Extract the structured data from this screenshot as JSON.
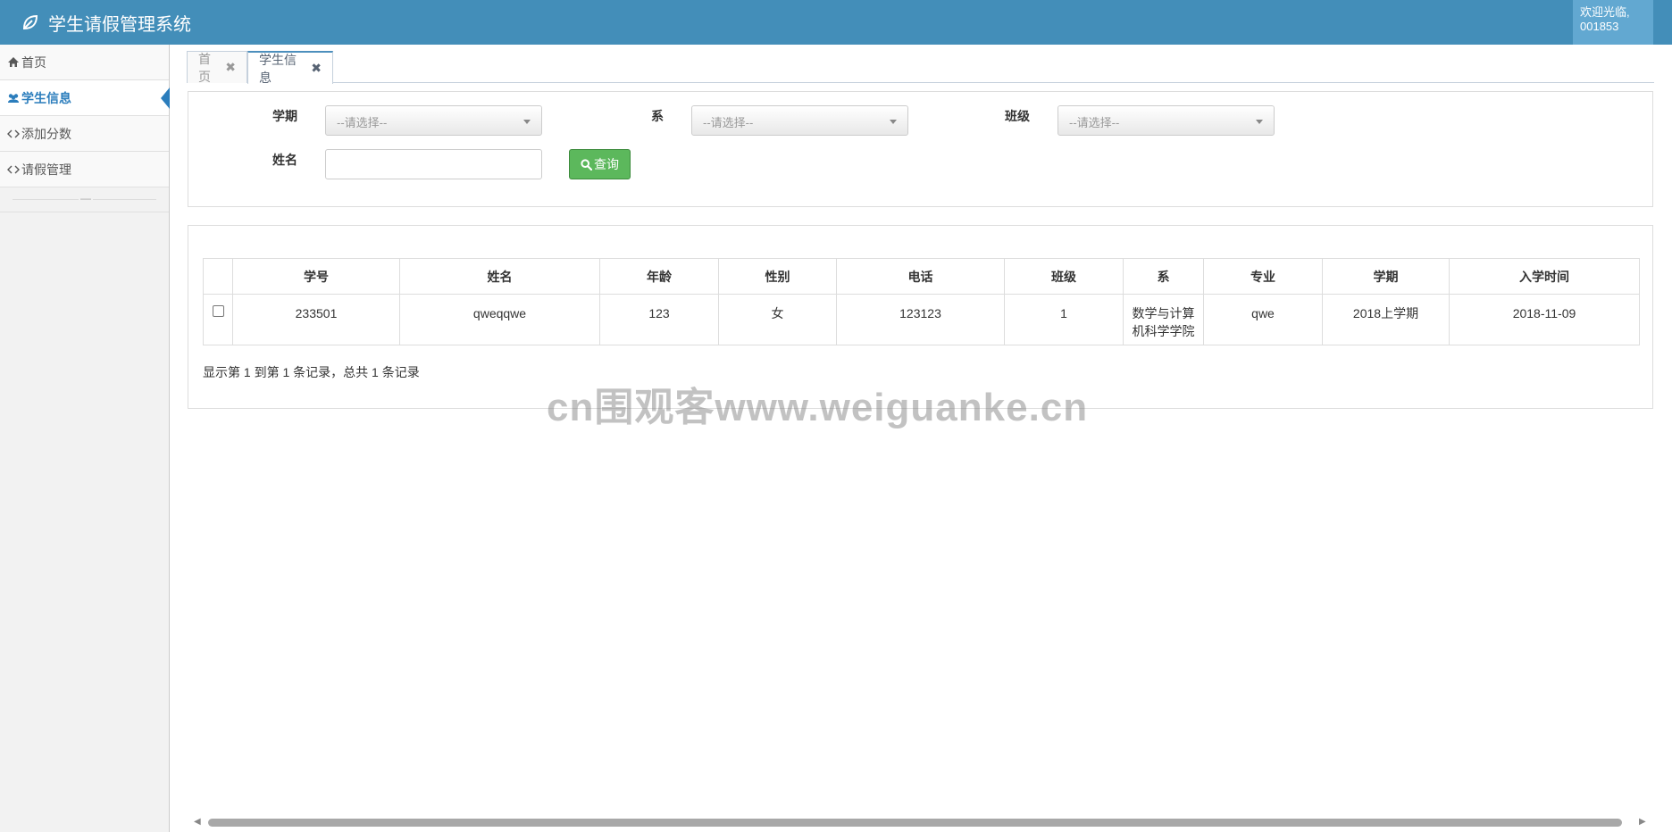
{
  "header": {
    "title": "学生请假管理系统",
    "welcome_line1": "欢迎光临,",
    "welcome_line2": "001853"
  },
  "sidebar": {
    "items": [
      {
        "label": "首页",
        "icon": "home-icon"
      },
      {
        "label": "学生信息",
        "icon": "users-icon",
        "active": true
      },
      {
        "label": "添加分数",
        "icon": "code-icon"
      },
      {
        "label": "请假管理",
        "icon": "code-icon"
      }
    ],
    "collapse_label": "—"
  },
  "tabs": [
    {
      "label": "首页",
      "close": "✖"
    },
    {
      "label": "学生信息",
      "close": "✖",
      "active": true
    }
  ],
  "search": {
    "term_label": "学期",
    "term_value": "--请选择--",
    "dept_label": "系",
    "dept_value": "--请选择--",
    "class_label": "班级",
    "class_value": "--请选择--",
    "name_label": "姓名",
    "name_value": "",
    "button_label": "查询"
  },
  "table": {
    "columns": [
      "学号",
      "姓名",
      "年龄",
      "性别",
      "电话",
      "班级",
      "系",
      "专业",
      "学期",
      "入学时间"
    ],
    "rows": [
      [
        "233501",
        "qweqqwe",
        "123",
        "女",
        "123123",
        "1",
        "数学与计算机科学学院",
        "qwe",
        "2018上学期",
        "2018-11-09"
      ]
    ],
    "pager_info": "显示第 1 到第 1 条记录，总共 1 条记录"
  },
  "watermark": "cn围观客www.weiguanke.cn",
  "colors": {
    "header": "#438eb9",
    "welcome_box": "#62a8d1",
    "active_nav": "#2b7dbc",
    "search_button": "#5cb85c"
  }
}
